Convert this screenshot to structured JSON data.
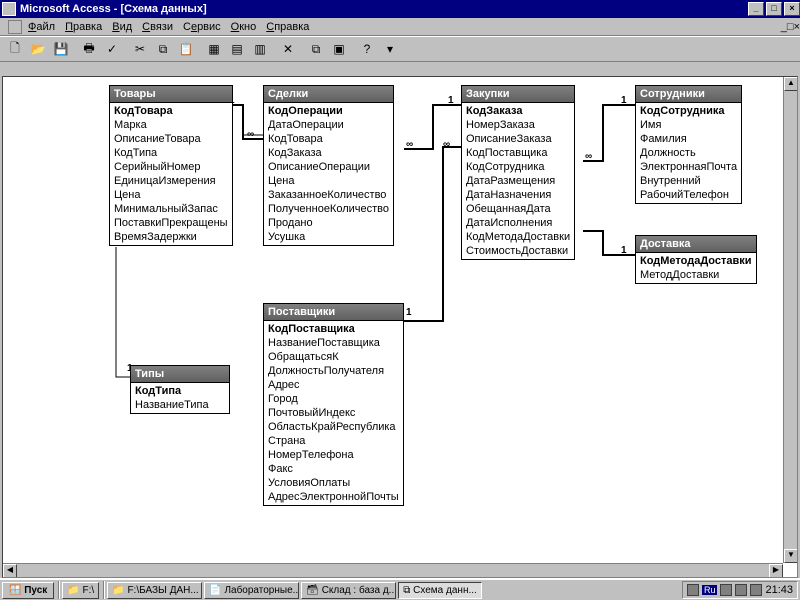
{
  "app": {
    "title": "Microsoft Access - [Схема данных]"
  },
  "menu": {
    "file": "Файл",
    "edit": "Правка",
    "view": "Вид",
    "relations": "Связи",
    "service": "Сервис",
    "window": "Окно",
    "help": "Справка"
  },
  "tables": {
    "tovary": {
      "title": "Товары",
      "fields": [
        "КодТовара",
        "Марка",
        "ОписаниеТовара",
        "КодТипа",
        "СерийныйНомер",
        "ЕдиницаИзмерения",
        "Цена",
        "МинимальныйЗапас",
        "ПоставкиПрекращены",
        "ВремяЗадержки"
      ],
      "pk": 0
    },
    "sdelki": {
      "title": "Сделки",
      "fields": [
        "КодОперации",
        "ДатаОперации",
        "КодТовара",
        "КодЗаказа",
        "ОписаниеОперации",
        "Цена",
        "ЗаказанноеКоличество",
        "ПолученноеКоличество",
        "Продано",
        "Усушка"
      ],
      "pk": 0
    },
    "zakupki": {
      "title": "Закупки",
      "fields": [
        "КодЗаказа",
        "НомерЗаказа",
        "ОписаниеЗаказа",
        "КодПоставщика",
        "КодСотрудника",
        "ДатаРазмещения",
        "ДатаНазначения",
        "ОбещаннаяДата",
        "ДатаИсполнения",
        "КодМетодаДоставки",
        "СтоимостьДоставки"
      ],
      "pk": 0
    },
    "sotrudniki": {
      "title": "Сотрудники",
      "fields": [
        "КодСотрудника",
        "Имя",
        "Фамилия",
        "Должность",
        "ЭлектроннаяПочта",
        "Внутренний",
        "РабочийТелефон"
      ],
      "pk": 0
    },
    "dostavka": {
      "title": "Доставка",
      "fields": [
        "КодМетодаДоставки",
        "МетодДоставки"
      ],
      "pk": 0
    },
    "tipy": {
      "title": "Типы",
      "fields": [
        "КодТипа",
        "НазваниеТипа"
      ],
      "pk": 0
    },
    "postavshiki": {
      "title": "Поставщики",
      "fields": [
        "КодПоставщика",
        "НазваниеПоставщика",
        "ОбращатьсяК",
        "ДолжностьПолучателя",
        "Адрес",
        "Город",
        "ПочтовыйИндекс",
        "ОбластьКрайРеспублика",
        "Страна",
        "НомерТелефона",
        "Факс",
        "УсловияОплаты",
        "АдресЭлектроннойПочты"
      ],
      "pk": 0
    }
  },
  "taskbar": {
    "start": "Пуск",
    "items": [
      "F:\\",
      "F:\\БАЗЫ ДАН...",
      "Лабораторные...",
      "Склад : база д...",
      "Схема данн..."
    ],
    "clock": "21:43",
    "lang": "Ru"
  },
  "rel_labels": {
    "one": "1",
    "many": "∞"
  }
}
